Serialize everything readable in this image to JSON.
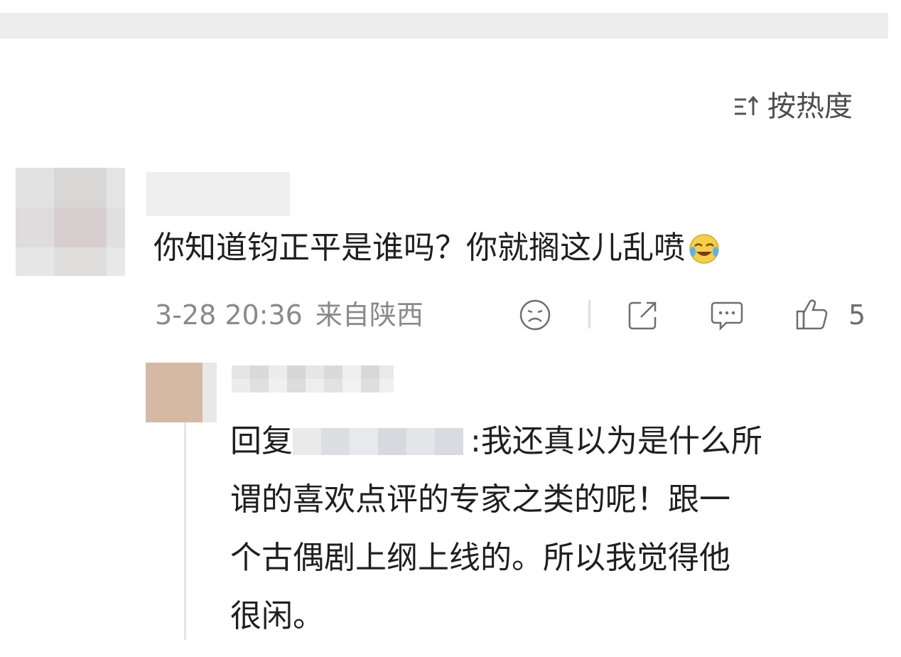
{
  "sort": {
    "label": "按热度",
    "icon": "sort-icon"
  },
  "comment": {
    "avatar_icon": "blurred-avatar",
    "text": "你知道钧正平是谁吗？你就搁这儿乱喷",
    "emoji": "laughing-crying-emoji",
    "time": "3-28 20:36",
    "location": "来自陕西",
    "actions": {
      "dislike_icon": "frown-face-icon",
      "share_icon": "share-icon",
      "comment_icon": "comment-bubble-icon",
      "like_icon": "thumbs-up-icon",
      "like_count": "5"
    }
  },
  "reply": {
    "avatar_icon": "blurred-avatar",
    "prefix": "回复",
    "after_mention": ":我还真以为是什么所",
    "lines": [
      "谓的喜欢点评的专家之类的呢！跟一",
      "个古偶剧上纲上线的。所以我觉得他",
      "很闲。"
    ]
  },
  "colors": {
    "background": "#ffffff",
    "top_bar": "#ededed",
    "text": "#1f1f1f",
    "meta": "#8a8a8a",
    "icon": "#6e6e6e"
  }
}
